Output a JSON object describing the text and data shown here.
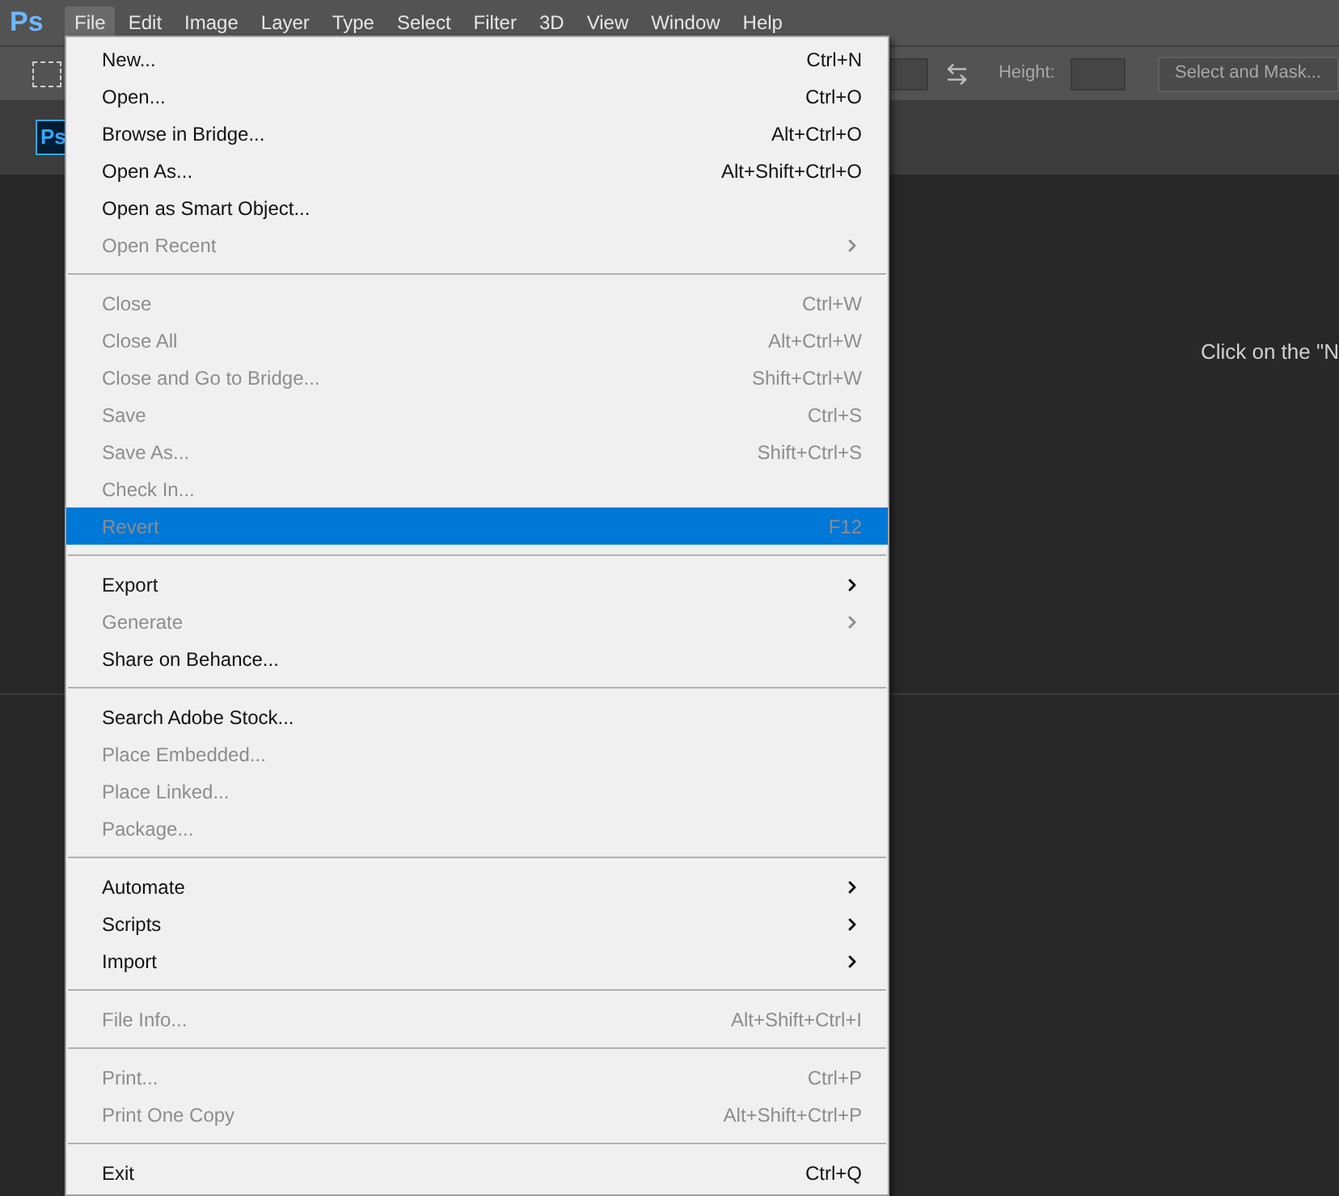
{
  "app": {
    "logo": "Ps"
  },
  "menu_bar": [
    {
      "label": "File",
      "selected": true
    },
    {
      "label": "Edit",
      "selected": false
    },
    {
      "label": "Image",
      "selected": false
    },
    {
      "label": "Layer",
      "selected": false
    },
    {
      "label": "Type",
      "selected": false
    },
    {
      "label": "Select",
      "selected": false
    },
    {
      "label": "Filter",
      "selected": false
    },
    {
      "label": "3D",
      "selected": false
    },
    {
      "label": "View",
      "selected": false
    },
    {
      "label": "Window",
      "selected": false
    },
    {
      "label": "Help",
      "selected": false
    }
  ],
  "options_bar": {
    "height_label": "Height:",
    "select_and_mask": "Select and Mask..."
  },
  "document_tab": {
    "logo": "Ps"
  },
  "canvas_hint": "Click on the \"N",
  "file_menu": [
    [
      {
        "label": "New...",
        "shortcut": "Ctrl+N",
        "disabled": false,
        "submenu": false,
        "selected": false
      },
      {
        "label": "Open...",
        "shortcut": "Ctrl+O",
        "disabled": false,
        "submenu": false,
        "selected": false
      },
      {
        "label": "Browse in Bridge...",
        "shortcut": "Alt+Ctrl+O",
        "disabled": false,
        "submenu": false,
        "selected": false
      },
      {
        "label": "Open As...",
        "shortcut": "Alt+Shift+Ctrl+O",
        "disabled": false,
        "submenu": false,
        "selected": false
      },
      {
        "label": "Open as Smart Object...",
        "disabled": false,
        "submenu": false,
        "selected": false
      },
      {
        "label": "Open Recent",
        "disabled": true,
        "submenu": true,
        "selected": false
      }
    ],
    [
      {
        "label": "Close",
        "shortcut": "Ctrl+W",
        "disabled": true,
        "submenu": false,
        "selected": false
      },
      {
        "label": "Close All",
        "shortcut": "Alt+Ctrl+W",
        "disabled": true,
        "submenu": false,
        "selected": false
      },
      {
        "label": "Close and Go to Bridge...",
        "shortcut": "Shift+Ctrl+W",
        "disabled": true,
        "submenu": false,
        "selected": false
      },
      {
        "label": "Save",
        "shortcut": "Ctrl+S",
        "disabled": true,
        "submenu": false,
        "selected": false
      },
      {
        "label": "Save As...",
        "shortcut": "Shift+Ctrl+S",
        "disabled": true,
        "submenu": false,
        "selected": false
      },
      {
        "label": "Check In...",
        "disabled": true,
        "submenu": false,
        "selected": false
      },
      {
        "label": "Revert",
        "shortcut": "F12",
        "disabled": true,
        "submenu": false,
        "selected": true
      }
    ],
    [
      {
        "label": "Export",
        "disabled": false,
        "submenu": true,
        "selected": false
      },
      {
        "label": "Generate",
        "disabled": true,
        "submenu": true,
        "selected": false
      },
      {
        "label": "Share on Behance...",
        "disabled": false,
        "submenu": false,
        "selected": false
      }
    ],
    [
      {
        "label": "Search Adobe Stock...",
        "disabled": false,
        "submenu": false,
        "selected": false
      },
      {
        "label": "Place Embedded...",
        "disabled": true,
        "submenu": false,
        "selected": false
      },
      {
        "label": "Place Linked...",
        "disabled": true,
        "submenu": false,
        "selected": false
      },
      {
        "label": "Package...",
        "disabled": true,
        "submenu": false,
        "selected": false
      }
    ],
    [
      {
        "label": "Automate",
        "disabled": false,
        "submenu": true,
        "selected": false
      },
      {
        "label": "Scripts",
        "disabled": false,
        "submenu": true,
        "selected": false
      },
      {
        "label": "Import",
        "disabled": false,
        "submenu": true,
        "selected": false
      }
    ],
    [
      {
        "label": "File Info...",
        "shortcut": "Alt+Shift+Ctrl+I",
        "disabled": true,
        "submenu": false,
        "selected": false
      }
    ],
    [
      {
        "label": "Print...",
        "shortcut": "Ctrl+P",
        "disabled": true,
        "submenu": false,
        "selected": false
      },
      {
        "label": "Print One Copy",
        "shortcut": "Alt+Shift+Ctrl+P",
        "disabled": true,
        "submenu": false,
        "selected": false
      }
    ],
    [
      {
        "label": "Exit",
        "shortcut": "Ctrl+Q",
        "disabled": false,
        "submenu": false,
        "selected": false
      }
    ]
  ]
}
